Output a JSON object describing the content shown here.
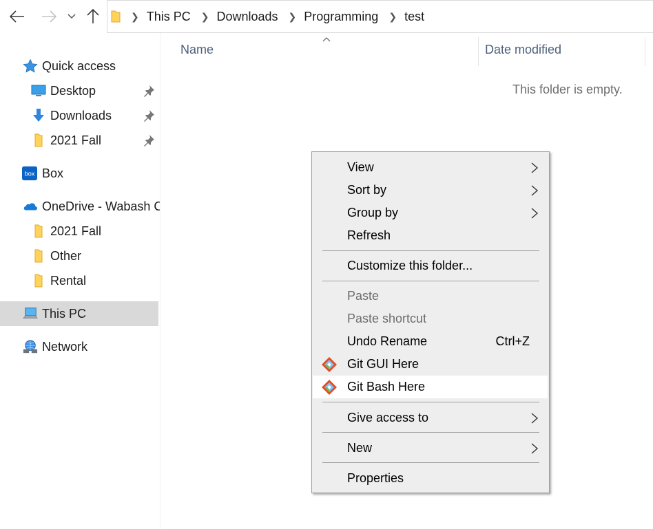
{
  "nav": {
    "back_icon": "arrow-left-icon",
    "forward_icon": "arrow-right-icon",
    "recent_icon": "chevron-down-icon",
    "up_icon": "arrow-up-icon"
  },
  "address": {
    "folder_icon": "folder-icon",
    "crumbs": [
      "This PC",
      "Downloads",
      "Programming",
      "test"
    ]
  },
  "sidebar": {
    "items": [
      {
        "label": "Quick access",
        "icon": "star-icon"
      },
      {
        "label": "Desktop",
        "icon": "desktop-icon",
        "pinned": true
      },
      {
        "label": "Downloads",
        "icon": "download-arrow-icon",
        "pinned": true
      },
      {
        "label": "2021 Fall",
        "icon": "folder-icon",
        "pinned": true
      },
      {
        "label": "Box",
        "icon": "box-icon",
        "badge": "box"
      },
      {
        "label": "OneDrive - Wabash C",
        "icon": "cloud-icon"
      },
      {
        "label": "2021 Fall",
        "icon": "folder-icon"
      },
      {
        "label": "Other",
        "icon": "folder-icon"
      },
      {
        "label": "Rental",
        "icon": "folder-icon"
      },
      {
        "label": "This PC",
        "icon": "computer-icon",
        "selected": true
      },
      {
        "label": "Network",
        "icon": "network-icon"
      }
    ]
  },
  "columns": {
    "name": "Name",
    "date_modified": "Date modified"
  },
  "content": {
    "empty_text": "This folder is empty."
  },
  "context_menu": {
    "items": [
      {
        "label": "View",
        "submenu": true
      },
      {
        "label": "Sort by",
        "submenu": true
      },
      {
        "label": "Group by",
        "submenu": true
      },
      {
        "label": "Refresh"
      },
      {
        "label": "Customize this folder..."
      },
      {
        "label": "Paste",
        "disabled": true
      },
      {
        "label": "Paste shortcut",
        "disabled": true
      },
      {
        "label": "Undo Rename",
        "shortcut": "Ctrl+Z"
      },
      {
        "label": "Git GUI Here",
        "icon": "git-icon"
      },
      {
        "label": "Git Bash Here",
        "icon": "git-icon",
        "hovered": true
      },
      {
        "label": "Give access to",
        "submenu": true
      },
      {
        "label": "New",
        "submenu": true
      },
      {
        "label": "Properties"
      }
    ]
  },
  "colors": {
    "accent": "#0078d7",
    "folder_yellow": "#ffd35c",
    "selection": "#d9d9d9",
    "menu_bg": "#eeeeee",
    "column_header_text": "#4c607a"
  }
}
